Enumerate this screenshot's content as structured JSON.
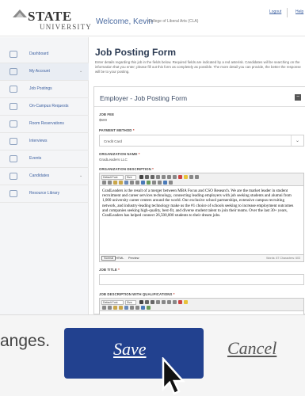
{
  "header": {
    "logo_text": "STATE",
    "logo_subtext": "UNIVERSITY",
    "welcome": "Welcome, Kevin",
    "college": "College of Liberal Arts (CLA)",
    "logout": "Logout",
    "help": "Help"
  },
  "sidebar": {
    "items": [
      {
        "label": "Dashboard",
        "icon": "dashboard-icon"
      },
      {
        "label": "My Account",
        "icon": "account-icon",
        "expandable": true
      },
      {
        "label": "Job Postings",
        "icon": "briefcase-icon"
      },
      {
        "label": "On-Campus Requests",
        "icon": "building-icon"
      },
      {
        "label": "Room Reservations",
        "icon": "calendar-icon"
      },
      {
        "label": "Interviews",
        "icon": "interview-icon"
      },
      {
        "label": "Events",
        "icon": "events-icon"
      },
      {
        "label": "Candidates",
        "icon": "candidates-icon",
        "expandable": true
      },
      {
        "label": "Resource Library",
        "icon": "library-icon"
      }
    ]
  },
  "main": {
    "title": "Job Posting Form",
    "intro": "Enter details regarding this job in the fields below. Required fields are indicated by a red asterisk. Candidates will be searching on the information that you enter; please fill out this form as completely as possible. The more detail you can provide, the better the response will be to your posting."
  },
  "form": {
    "panel_title": "Employer - Job Posting Form",
    "job_fee_label": "JOB FEE",
    "job_fee_value": "$500",
    "payment_label": "PAYMENT METHOD",
    "payment_value": "Credit Card",
    "org_name_label": "ORGANIZATION NAME",
    "org_name_value": "GradLeaders LLC",
    "org_desc_label": "ORGANIZATION DESCRIPTION",
    "org_desc_text": "GradLeaders is the result of a merger between MBA Focus and CSO Research. We are the market leader in student recruitment and career services technology, connecting leading employers with job seeking students and alumni from 1,000 university career centers around the world. Our exclusive school partnerships, extensive campus recruiting network, and industry-leading technology make us the #1 choice of schools seeking to increase employment outcomes and companies seeking high-quality, best-fit, and diverse student talent to join their teams. Over the last 30+ years, GradLeaders has helped connect 26,500,000 students to their dream jobs.",
    "editor_tabs": [
      "Normal",
      "HTML",
      "Preview"
    ],
    "word_count": "Words: 87   Characters: 603",
    "toolbar_font": "Default Font",
    "toolbar_size": "Size",
    "job_title_label": "JOB TITLE",
    "job_desc_label": "JOB DESCRIPTION WITH QUALIFICATIONS",
    "required_mark": "*"
  },
  "footer": {
    "changes_text": "anges.",
    "save_label": "Save",
    "cancel_label": "Cancel"
  }
}
